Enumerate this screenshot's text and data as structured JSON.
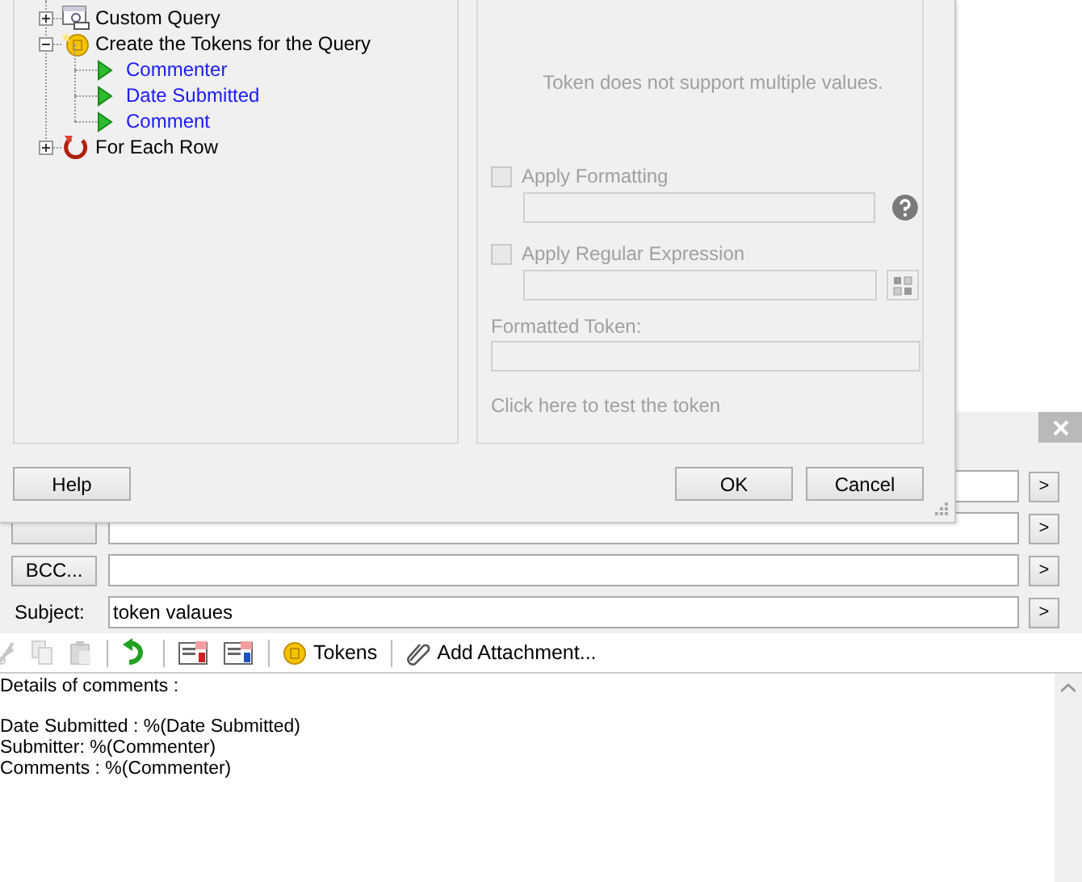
{
  "dialog": {
    "tree": [
      {
        "label": "Custom Query",
        "kind": "query",
        "expanded": false
      },
      {
        "label": "Create the Tokens for the Query",
        "kind": "tokens",
        "expanded": true,
        "children": [
          {
            "label": "Commenter"
          },
          {
            "label": "Date Submitted"
          },
          {
            "label": "Comment"
          }
        ]
      },
      {
        "label": "For Each Row",
        "kind": "loop",
        "expanded": false
      }
    ],
    "token_panel": {
      "message": "Token does not support multiple values.",
      "options": [
        {
          "label": "Apply Formatting",
          "checked": false,
          "disabled": true,
          "kind": "help"
        },
        {
          "label": "Apply Regular Expression",
          "checked": false,
          "disabled": true,
          "kind": "grid"
        }
      ],
      "formatted_token_label": "Formatted Token:",
      "test_link": "Click here to test the token"
    },
    "buttons": [
      "Help",
      "OK",
      "Cancel"
    ]
  },
  "email": {
    "rows": [
      {
        "kind": "covered"
      },
      {
        "kind": "button"
      },
      {
        "kind": "button",
        "label": "BCC..."
      },
      {
        "kind": "text",
        "label": "Subject:",
        "value": "token valaues"
      }
    ],
    "more_button": ">",
    "toolbar": [
      {
        "kind": "cut",
        "disabled": true
      },
      {
        "kind": "copy",
        "disabled": true
      },
      {
        "kind": "paste",
        "disabled": true
      },
      {
        "kind": "separator"
      },
      {
        "kind": "undo",
        "disabled": false
      },
      {
        "kind": "separator"
      },
      {
        "kind": "redcard",
        "disabled": false
      },
      {
        "kind": "bluecard",
        "disabled": false
      },
      {
        "kind": "separator"
      },
      {
        "kind": "tokens",
        "label": "Tokens"
      },
      {
        "kind": "separator"
      },
      {
        "kind": "attach",
        "label": "Add Attachment..."
      }
    ],
    "body": [
      [
        "Details of comments :"
      ],
      [
        "Date Submitted : %(Date Submitted)",
        "Submitter: %(Commenter)",
        "Comments : %(Commenter)"
      ]
    ]
  }
}
